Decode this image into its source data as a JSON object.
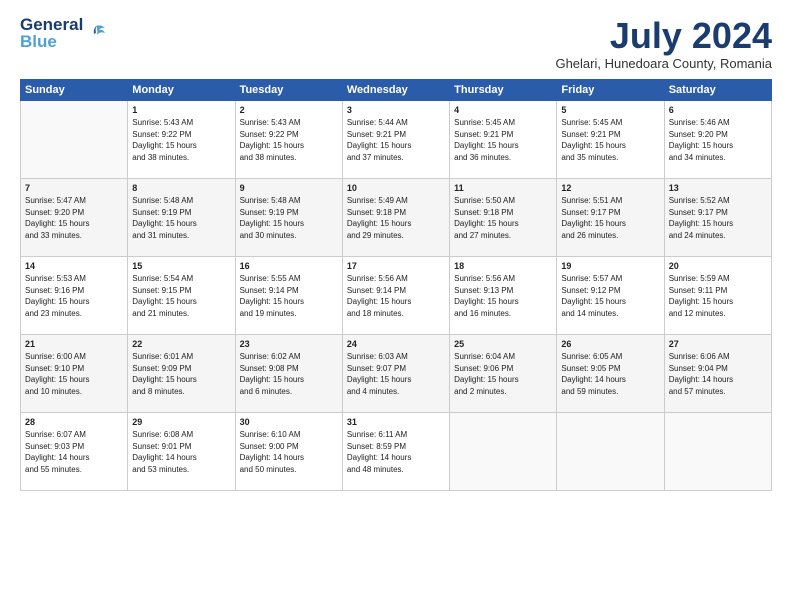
{
  "logo": {
    "line1": "General",
    "line2": "Blue"
  },
  "title": "July 2024",
  "subtitle": "Ghelari, Hunedoara County, Romania",
  "days_of_week": [
    "Sunday",
    "Monday",
    "Tuesday",
    "Wednesday",
    "Thursday",
    "Friday",
    "Saturday"
  ],
  "weeks": [
    [
      {
        "day": "",
        "content": ""
      },
      {
        "day": "1",
        "content": "Sunrise: 5:43 AM\nSunset: 9:22 PM\nDaylight: 15 hours\nand 38 minutes."
      },
      {
        "day": "2",
        "content": "Sunrise: 5:43 AM\nSunset: 9:22 PM\nDaylight: 15 hours\nand 38 minutes."
      },
      {
        "day": "3",
        "content": "Sunrise: 5:44 AM\nSunset: 9:21 PM\nDaylight: 15 hours\nand 37 minutes."
      },
      {
        "day": "4",
        "content": "Sunrise: 5:45 AM\nSunset: 9:21 PM\nDaylight: 15 hours\nand 36 minutes."
      },
      {
        "day": "5",
        "content": "Sunrise: 5:45 AM\nSunset: 9:21 PM\nDaylight: 15 hours\nand 35 minutes."
      },
      {
        "day": "6",
        "content": "Sunrise: 5:46 AM\nSunset: 9:20 PM\nDaylight: 15 hours\nand 34 minutes."
      }
    ],
    [
      {
        "day": "7",
        "content": "Sunrise: 5:47 AM\nSunset: 9:20 PM\nDaylight: 15 hours\nand 33 minutes."
      },
      {
        "day": "8",
        "content": "Sunrise: 5:48 AM\nSunset: 9:19 PM\nDaylight: 15 hours\nand 31 minutes."
      },
      {
        "day": "9",
        "content": "Sunrise: 5:48 AM\nSunset: 9:19 PM\nDaylight: 15 hours\nand 30 minutes."
      },
      {
        "day": "10",
        "content": "Sunrise: 5:49 AM\nSunset: 9:18 PM\nDaylight: 15 hours\nand 29 minutes."
      },
      {
        "day": "11",
        "content": "Sunrise: 5:50 AM\nSunset: 9:18 PM\nDaylight: 15 hours\nand 27 minutes."
      },
      {
        "day": "12",
        "content": "Sunrise: 5:51 AM\nSunset: 9:17 PM\nDaylight: 15 hours\nand 26 minutes."
      },
      {
        "day": "13",
        "content": "Sunrise: 5:52 AM\nSunset: 9:17 PM\nDaylight: 15 hours\nand 24 minutes."
      }
    ],
    [
      {
        "day": "14",
        "content": "Sunrise: 5:53 AM\nSunset: 9:16 PM\nDaylight: 15 hours\nand 23 minutes."
      },
      {
        "day": "15",
        "content": "Sunrise: 5:54 AM\nSunset: 9:15 PM\nDaylight: 15 hours\nand 21 minutes."
      },
      {
        "day": "16",
        "content": "Sunrise: 5:55 AM\nSunset: 9:14 PM\nDaylight: 15 hours\nand 19 minutes."
      },
      {
        "day": "17",
        "content": "Sunrise: 5:56 AM\nSunset: 9:14 PM\nDaylight: 15 hours\nand 18 minutes."
      },
      {
        "day": "18",
        "content": "Sunrise: 5:56 AM\nSunset: 9:13 PM\nDaylight: 15 hours\nand 16 minutes."
      },
      {
        "day": "19",
        "content": "Sunrise: 5:57 AM\nSunset: 9:12 PM\nDaylight: 15 hours\nand 14 minutes."
      },
      {
        "day": "20",
        "content": "Sunrise: 5:59 AM\nSunset: 9:11 PM\nDaylight: 15 hours\nand 12 minutes."
      }
    ],
    [
      {
        "day": "21",
        "content": "Sunrise: 6:00 AM\nSunset: 9:10 PM\nDaylight: 15 hours\nand 10 minutes."
      },
      {
        "day": "22",
        "content": "Sunrise: 6:01 AM\nSunset: 9:09 PM\nDaylight: 15 hours\nand 8 minutes."
      },
      {
        "day": "23",
        "content": "Sunrise: 6:02 AM\nSunset: 9:08 PM\nDaylight: 15 hours\nand 6 minutes."
      },
      {
        "day": "24",
        "content": "Sunrise: 6:03 AM\nSunset: 9:07 PM\nDaylight: 15 hours\nand 4 minutes."
      },
      {
        "day": "25",
        "content": "Sunrise: 6:04 AM\nSunset: 9:06 PM\nDaylight: 15 hours\nand 2 minutes."
      },
      {
        "day": "26",
        "content": "Sunrise: 6:05 AM\nSunset: 9:05 PM\nDaylight: 14 hours\nand 59 minutes."
      },
      {
        "day": "27",
        "content": "Sunrise: 6:06 AM\nSunset: 9:04 PM\nDaylight: 14 hours\nand 57 minutes."
      }
    ],
    [
      {
        "day": "28",
        "content": "Sunrise: 6:07 AM\nSunset: 9:03 PM\nDaylight: 14 hours\nand 55 minutes."
      },
      {
        "day": "29",
        "content": "Sunrise: 6:08 AM\nSunset: 9:01 PM\nDaylight: 14 hours\nand 53 minutes."
      },
      {
        "day": "30",
        "content": "Sunrise: 6:10 AM\nSunset: 9:00 PM\nDaylight: 14 hours\nand 50 minutes."
      },
      {
        "day": "31",
        "content": "Sunrise: 6:11 AM\nSunset: 8:59 PM\nDaylight: 14 hours\nand 48 minutes."
      },
      {
        "day": "",
        "content": ""
      },
      {
        "day": "",
        "content": ""
      },
      {
        "day": "",
        "content": ""
      }
    ]
  ]
}
